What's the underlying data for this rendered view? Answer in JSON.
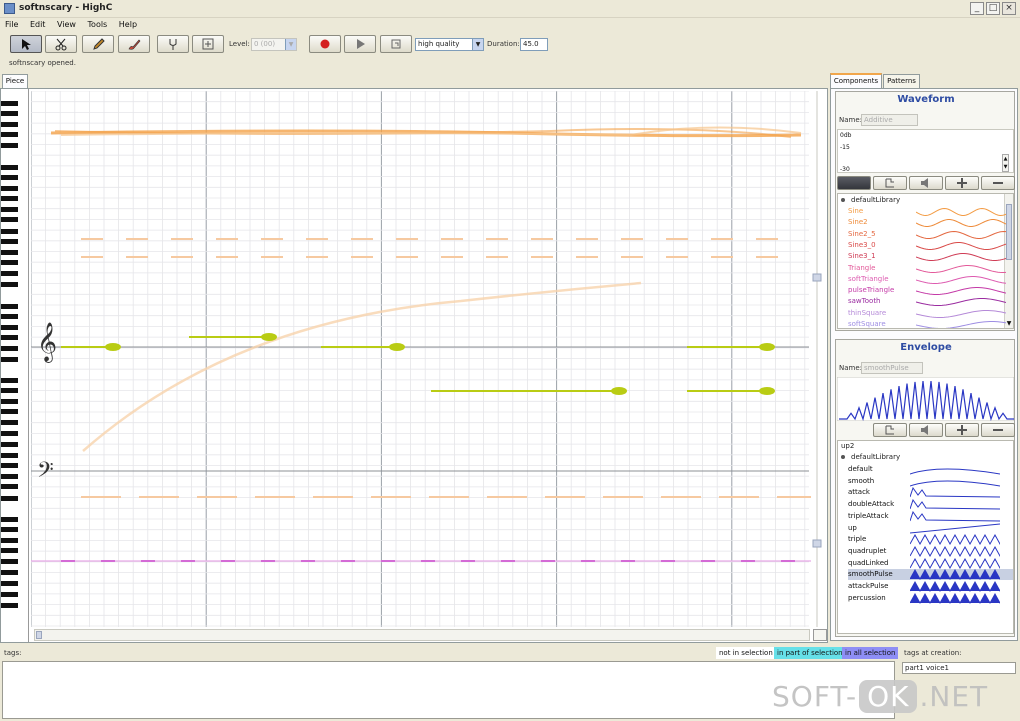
{
  "window": {
    "title": "softnscary - HighC",
    "minimize": "_",
    "maximize": "□",
    "close": "×"
  },
  "menu": [
    "File",
    "Edit",
    "View",
    "Tools",
    "Help"
  ],
  "toolbar": {
    "tools": [
      "select-arrow-icon",
      "scissors-icon",
      "pencil-icon",
      "brush-icon",
      "tuning-fork-icon",
      "zoom-icon"
    ],
    "level_label": "Level:",
    "level_value": "0 (00)",
    "quality_value": "high quality",
    "duration_label": "Duration:",
    "duration_value": "45.0"
  },
  "status": "softnscary opened.",
  "piece_tab": "Piece",
  "right_tabs": [
    "Components",
    "Patterns"
  ],
  "waveform": {
    "title": "Waveform",
    "name_label": "Name:",
    "name_value": "Additive",
    "db_labels": [
      "0db",
      "-15",
      "-30"
    ],
    "library_root": "defaultLibrary",
    "items": [
      {
        "label": "Sine",
        "color": "#f39b43"
      },
      {
        "label": "Sine2",
        "color": "#ee8b3a"
      },
      {
        "label": "Sine2_5",
        "color": "#e46840"
      },
      {
        "label": "Sine3_0",
        "color": "#d94a48"
      },
      {
        "label": "Sine3_1",
        "color": "#cf3c55"
      },
      {
        "label": "Triangle",
        "color": "#e35a9a"
      },
      {
        "label": "softTriangle",
        "color": "#dd5bb0"
      },
      {
        "label": "pulseTriangle",
        "color": "#c43aa7"
      },
      {
        "label": "sawTooth",
        "color": "#9a2ba0"
      },
      {
        "label": "thinSquare",
        "color": "#b58ad8"
      },
      {
        "label": "softSquare",
        "color": "#9e8ee3"
      }
    ]
  },
  "envelope": {
    "title": "Envelope",
    "name_label": "Name:",
    "name_value": "smoothPulse",
    "top_item": "up2",
    "library_root": "defaultLibrary",
    "items": [
      "default",
      "smooth",
      "attack",
      "doubleAttack",
      "tripleAttack",
      "up",
      "triple",
      "quadruplet",
      "quadLinked",
      "smoothPulse",
      "attackPulse",
      "percussion"
    ],
    "selected": "smoothPulse"
  },
  "bottom": {
    "tags_label": "tags:",
    "legend": [
      {
        "label": "not in selection",
        "bg": "#ffffff"
      },
      {
        "label": "in part of selection",
        "bg": "#66e0e8"
      },
      {
        "label": "in all selection",
        "bg": "#8e8ef5"
      }
    ],
    "tags_at_creation_label": "tags at creation:",
    "tags_at_creation_value": "part1 voice1"
  },
  "watermark": {
    "left": "SOFT-",
    "ok": "OK",
    "right": ".NET"
  },
  "colors": {
    "orange": "#f4a24a",
    "lime": "#b9cc14",
    "pink": "#d46bd6",
    "envblue": "#2a37c4",
    "title": "#2e4ca3"
  }
}
